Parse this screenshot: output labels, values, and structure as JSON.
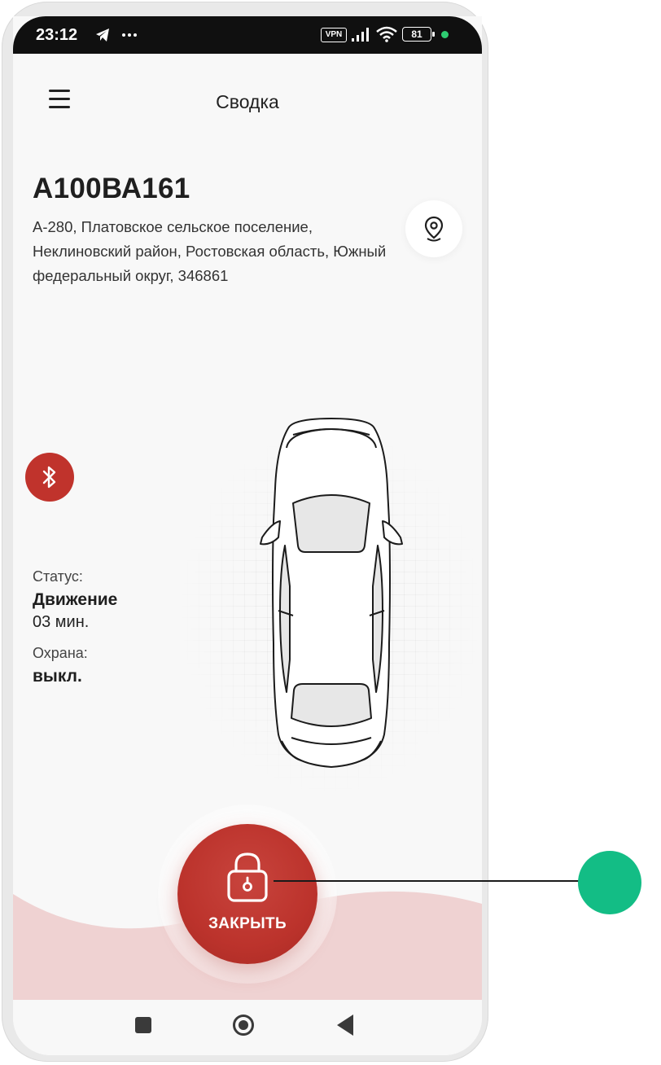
{
  "status_bar": {
    "time": "23:12",
    "vpn": "VPN",
    "battery": "81",
    "icons": [
      "telegram-icon",
      "more-dots-icon",
      "signal-icon",
      "wifi-icon",
      "battery-icon"
    ]
  },
  "header": {
    "title": "Сводка"
  },
  "vehicle": {
    "plate": "А100ВА161",
    "address": "А-280, Платовское сельское поселение, Неклиновский район, Ростовская область, Южный федеральный округ, 346861"
  },
  "status": {
    "status_label": "Статус:",
    "status_value": "Движение",
    "duration": "03 мин.",
    "guard_label": "Охрана:",
    "guard_value": "выкл."
  },
  "action": {
    "lock_label": "ЗАКРЫТЬ"
  },
  "colors": {
    "accent": "#c0332c",
    "wave": "#efd2d2",
    "marker": "#13bd85"
  }
}
